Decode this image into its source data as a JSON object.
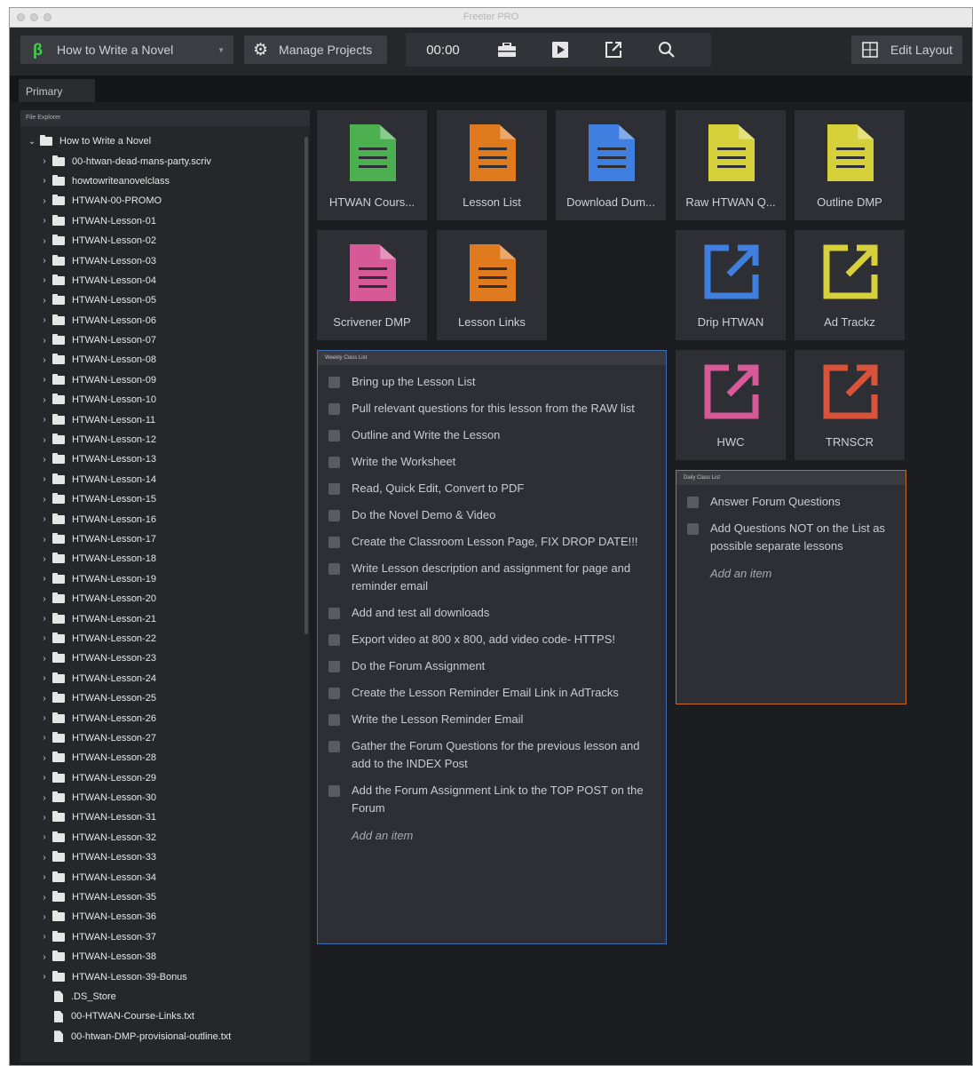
{
  "window": {
    "title": "Freeter PRO"
  },
  "toolbar": {
    "project": "How to Write a Novel",
    "manage_projects": "Manage Projects",
    "timer": "00:00",
    "edit_layout": "Edit Layout"
  },
  "tabs": [
    {
      "label": "Primary"
    }
  ],
  "file_explorer": {
    "title": "File Explorer",
    "root": "How to Write a Novel",
    "items": [
      {
        "label": "00-htwan-dead-mans-party.scriv",
        "type": "folder"
      },
      {
        "label": "howtowriteanovelclass",
        "type": "folder"
      },
      {
        "label": "HTWAN-00-PROMO",
        "type": "folder"
      },
      {
        "label": "HTWAN-Lesson-01",
        "type": "folder"
      },
      {
        "label": "HTWAN-Lesson-02",
        "type": "folder"
      },
      {
        "label": "HTWAN-Lesson-03",
        "type": "folder"
      },
      {
        "label": "HTWAN-Lesson-04",
        "type": "folder"
      },
      {
        "label": "HTWAN-Lesson-05",
        "type": "folder"
      },
      {
        "label": "HTWAN-Lesson-06",
        "type": "folder"
      },
      {
        "label": "HTWAN-Lesson-07",
        "type": "folder"
      },
      {
        "label": "HTWAN-Lesson-08",
        "type": "folder"
      },
      {
        "label": "HTWAN-Lesson-09",
        "type": "folder"
      },
      {
        "label": "HTWAN-Lesson-10",
        "type": "folder"
      },
      {
        "label": "HTWAN-Lesson-11",
        "type": "folder"
      },
      {
        "label": "HTWAN-Lesson-12",
        "type": "folder"
      },
      {
        "label": "HTWAN-Lesson-13",
        "type": "folder"
      },
      {
        "label": "HTWAN-Lesson-14",
        "type": "folder"
      },
      {
        "label": "HTWAN-Lesson-15",
        "type": "folder"
      },
      {
        "label": "HTWAN-Lesson-16",
        "type": "folder"
      },
      {
        "label": "HTWAN-Lesson-17",
        "type": "folder"
      },
      {
        "label": "HTWAN-Lesson-18",
        "type": "folder"
      },
      {
        "label": "HTWAN-Lesson-19",
        "type": "folder"
      },
      {
        "label": "HTWAN-Lesson-20",
        "type": "folder"
      },
      {
        "label": "HTWAN-Lesson-21",
        "type": "folder"
      },
      {
        "label": "HTWAN-Lesson-22",
        "type": "folder"
      },
      {
        "label": "HTWAN-Lesson-23",
        "type": "folder"
      },
      {
        "label": "HTWAN-Lesson-24",
        "type": "folder"
      },
      {
        "label": "HTWAN-Lesson-25",
        "type": "folder"
      },
      {
        "label": "HTWAN-Lesson-26",
        "type": "folder"
      },
      {
        "label": "HTWAN-Lesson-27",
        "type": "folder"
      },
      {
        "label": "HTWAN-Lesson-28",
        "type": "folder"
      },
      {
        "label": "HTWAN-Lesson-29",
        "type": "folder"
      },
      {
        "label": "HTWAN-Lesson-30",
        "type": "folder"
      },
      {
        "label": "HTWAN-Lesson-31",
        "type": "folder"
      },
      {
        "label": "HTWAN-Lesson-32",
        "type": "folder"
      },
      {
        "label": "HTWAN-Lesson-33",
        "type": "folder"
      },
      {
        "label": "HTWAN-Lesson-34",
        "type": "folder"
      },
      {
        "label": "HTWAN-Lesson-35",
        "type": "folder"
      },
      {
        "label": "HTWAN-Lesson-36",
        "type": "folder"
      },
      {
        "label": "HTWAN-Lesson-37",
        "type": "folder"
      },
      {
        "label": "HTWAN-Lesson-38",
        "type": "folder"
      },
      {
        "label": "HTWAN-Lesson-39-Bonus",
        "type": "folder"
      },
      {
        "label": ".DS_Store",
        "type": "file"
      },
      {
        "label": "00-HTWAN-Course-Links.txt",
        "type": "file"
      },
      {
        "label": "00-htwan-DMP-provisional-outline.txt",
        "type": "file"
      }
    ]
  },
  "tiles": [
    {
      "label": "HTWAN Cours...",
      "kind": "doc",
      "color": "#4caf50"
    },
    {
      "label": "Lesson List",
      "kind": "doc",
      "color": "#e07a1f"
    },
    {
      "label": "Download Dum...",
      "kind": "doc",
      "color": "#3f7fe0"
    },
    {
      "label": "Raw HTWAN Q...",
      "kind": "doc",
      "color": "#d6d13a"
    },
    {
      "label": "Outline DMP",
      "kind": "doc",
      "color": "#d6d13a"
    },
    {
      "label": "Scrivener DMP",
      "kind": "doc",
      "color": "#d65a98"
    },
    {
      "label": "Lesson Links",
      "kind": "doc",
      "color": "#e07a1f"
    },
    {
      "label": "Drip HTWAN",
      "kind": "link",
      "color": "#3f7fe0"
    },
    {
      "label": "Ad Trackz",
      "kind": "link",
      "color": "#d6d13a"
    },
    {
      "label": "HWC",
      "kind": "link",
      "color": "#d65a98"
    },
    {
      "label": "TRNSCR",
      "kind": "link",
      "color": "#d9533a"
    }
  ],
  "weekly": {
    "title": "Weekly Class List",
    "add": "Add an item",
    "items": [
      "Bring up the Lesson List",
      "Pull relevant questions for this lesson from the RAW list",
      "Outline and Write the Lesson",
      "Write the Worksheet",
      "Read, Quick Edit, Convert to PDF",
      "Do the Novel Demo & Video",
      "Create the Classroom Lesson Page, FIX DROP DATE!!!",
      "Write Lesson description and assignment for page and reminder email",
      "Add and test all downloads",
      "Export video at 800 x 800, add video code- HTTPS!",
      "Do the Forum Assignment",
      "Create the Lesson Reminder Email Link in AdTracks",
      "Write the Lesson Reminder Email",
      "Gather the Forum Questions for the previous lesson and add to the INDEX Post",
      "Add the Forum Assignment Link to the TOP POST on the Forum"
    ]
  },
  "daily": {
    "title": "Daily Class List",
    "add": "Add an item",
    "items": [
      "Answer Forum Questions",
      "Add Questions NOT on the List as possible separate lessons"
    ]
  },
  "colors": {
    "beta": "#3fd14a",
    "weekly_border": "#3d6db3",
    "daily_border": "#c7692a"
  }
}
